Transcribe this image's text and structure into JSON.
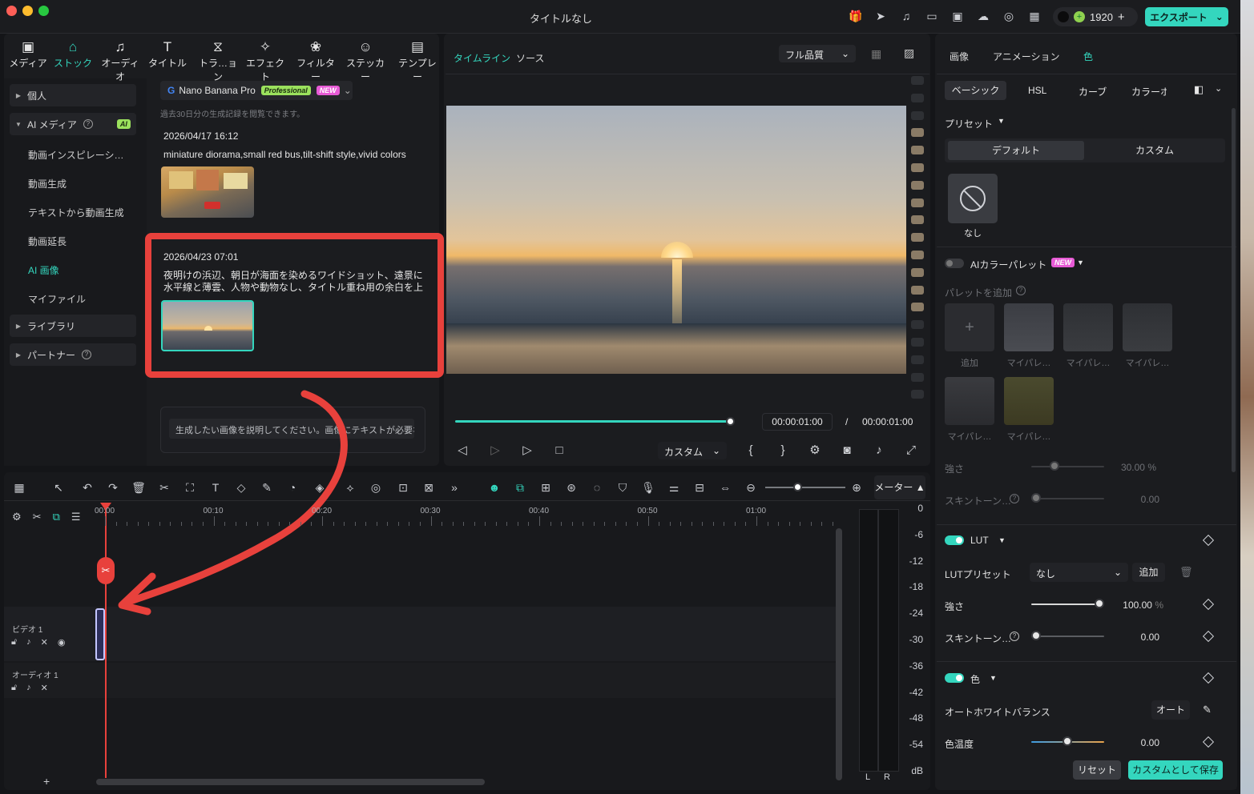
{
  "window": {
    "title": "タイトルなし",
    "credits": "1920",
    "export_label": "エクスポート"
  },
  "library_tabs": [
    {
      "label": "メディア",
      "icon": "media-icon"
    },
    {
      "label": "ストック",
      "icon": "stock-icon"
    },
    {
      "label": "オーディオ",
      "icon": "audio-icon"
    },
    {
      "label": "タイトル",
      "icon": "title-icon"
    },
    {
      "label": "トラ…ョン",
      "icon": "transition-icon"
    },
    {
      "label": "エフェクト",
      "icon": "effect-icon"
    },
    {
      "label": "フィルター",
      "icon": "filter-icon"
    },
    {
      "label": "ステッカー",
      "icon": "sticker-icon"
    },
    {
      "label": "テンプレー",
      "icon": "template-icon"
    }
  ],
  "sidebar": {
    "personal": "個人",
    "ai_media": "AI メディア",
    "ai_badge": "AI",
    "sub_items": [
      "動画インスピレーシ…",
      "動画生成",
      "テキストから動画生成",
      "動画延長",
      "AI 画像",
      "マイファイル"
    ],
    "library": "ライブラリ",
    "partner": "パートナー"
  },
  "generator": {
    "model": "Nano Banana Pro",
    "badge_pro": "Professional",
    "badge_new": "NEW",
    "history_note": "過去30日分の生成記録を閲覧できます。",
    "entries": [
      {
        "date": "2026/04/17 16:12",
        "prompt": "miniature diorama,small red bus,tilt-shift style,vivid colors"
      },
      {
        "date": "2026/04/23 07:01",
        "prompt": "夜明けの浜辺、朝日が海面を染めるワイドショット、遠景に水平線と薄雲、人物や動物なし、タイトル重ね用の余白を上半…"
      }
    ],
    "prompt_placeholder": "生成したい画像を説明してください。画像にテキストが必要な場合は、そのテキストを引用符で囲んでください。"
  },
  "preview": {
    "tab_timeline": "タイムライン",
    "tab_source": "ソース",
    "quality": "フル品質",
    "current_time": "00:00:01:00",
    "separator": "/",
    "total_time": "00:00:01:00",
    "progress": 1.0,
    "custom_label": "カスタム"
  },
  "timeline": {
    "ruler": [
      "00:00",
      "00:10",
      "00:20",
      "00:30",
      "00:40",
      "00:50",
      "01:00"
    ],
    "meter_label": "メーター",
    "meter_scale": [
      "0",
      "-6",
      "-12",
      "-18",
      "-24",
      "-30",
      "-36",
      "-42",
      "-48",
      "-54",
      "dB"
    ],
    "meter_lr": [
      "L",
      "R"
    ],
    "video_track": "ビデオ 1",
    "audio_track": "オーディオ 1"
  },
  "properties": {
    "tabs": [
      "画像",
      "アニメーション",
      "色"
    ],
    "subtabs": [
      "ベーシック",
      "HSL",
      "カーブ",
      "カラーホ"
    ],
    "preset_label": "プリセット",
    "preset_default": "デフォルト",
    "preset_custom": "カスタム",
    "none_label": "なし",
    "ai_palette": "AIカラーパレット",
    "new_badge": "NEW",
    "add_palette": "パレットを追加",
    "palette_items": [
      "追加",
      "マイパレ…",
      "マイパレ…",
      "マイパレ…",
      "マイパレ…",
      "マイパレ…"
    ],
    "strength_label": "強さ",
    "strength_value_1": "30.00",
    "skin_label": "スキントーン…",
    "skin_value_1": "0.00",
    "lut_label": "LUT",
    "lut_preset_label": "LUTプリセット",
    "lut_preset_value": "なし",
    "lut_add": "追加",
    "lut_strength": "100.00",
    "lut_skin": "0.00",
    "percent": "%",
    "color_label": "色",
    "auto_wb_label": "オートホワイトバランス",
    "auto_btn": "オート",
    "temp_label": "色温度",
    "temp_value": "0.00",
    "reset_btn": "リセット",
    "save_custom_btn": "カスタムとして保存"
  },
  "colors": {
    "accent": "#34d6be",
    "annotation_red": "#e8413c"
  }
}
